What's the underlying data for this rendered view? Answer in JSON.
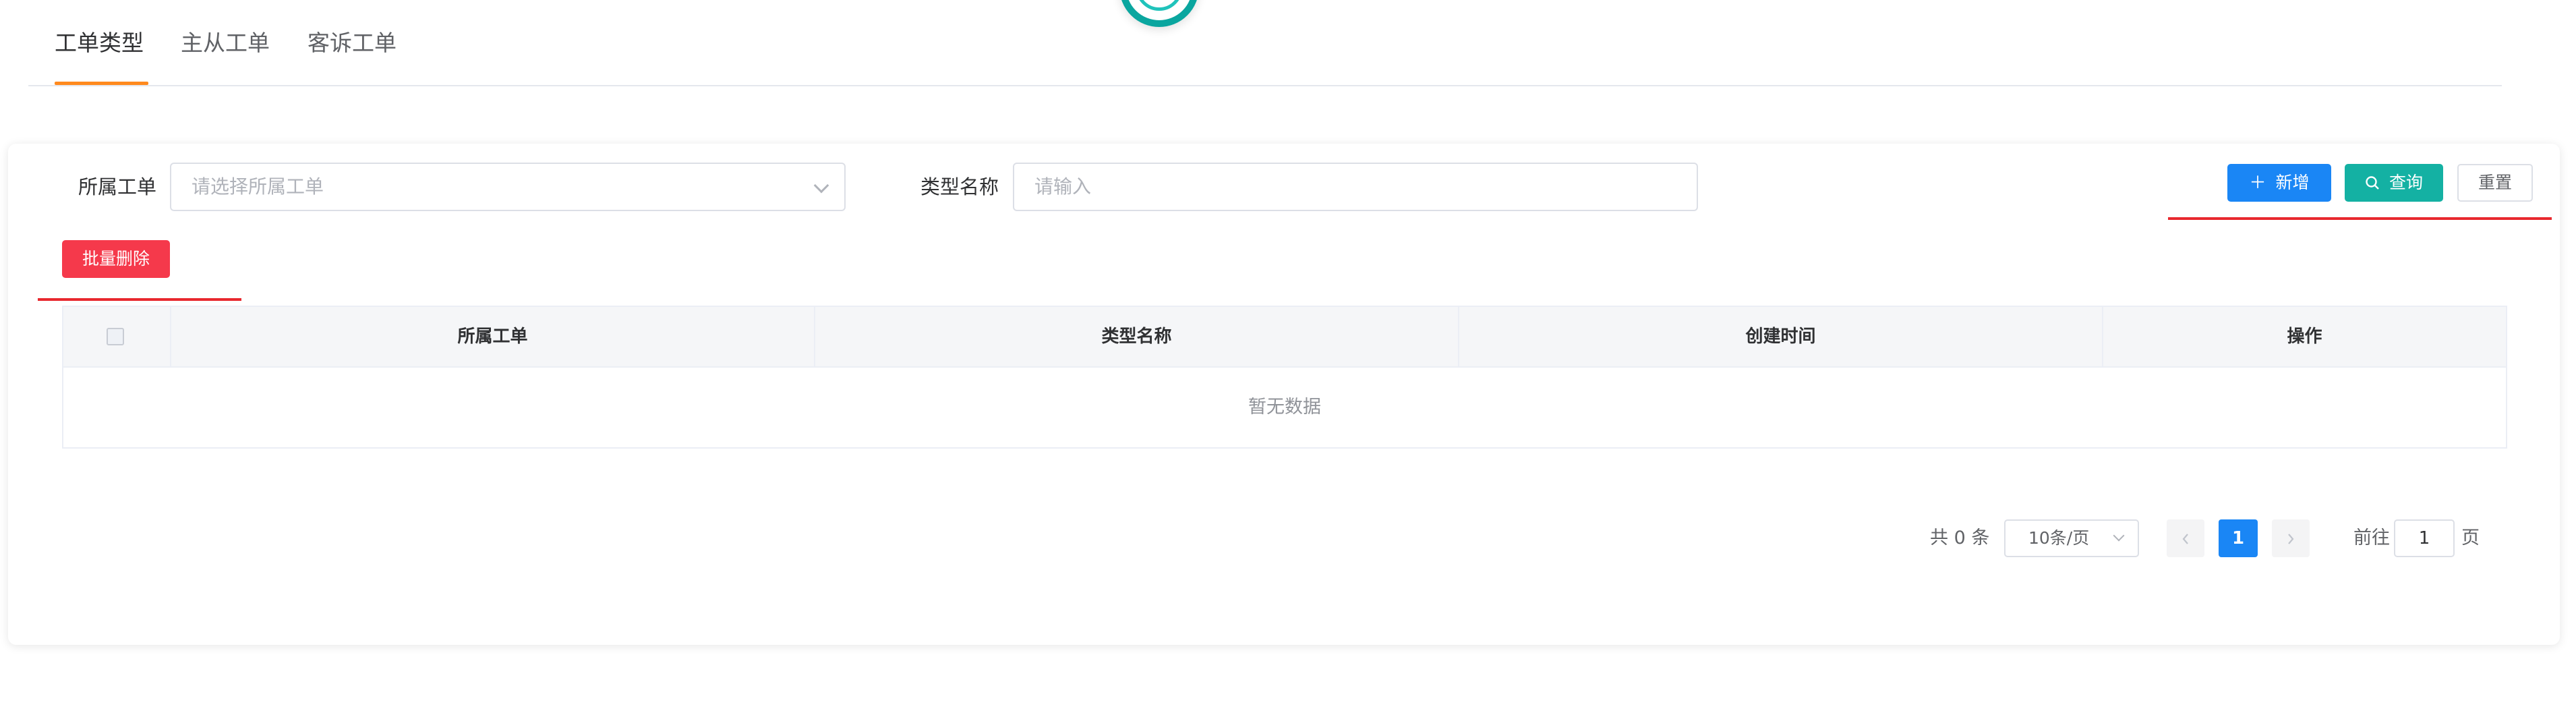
{
  "tabs": [
    {
      "label": "工单类型",
      "active": true
    },
    {
      "label": "主从工单",
      "active": false
    },
    {
      "label": "客诉工单",
      "active": false
    }
  ],
  "filters": {
    "order_label": "所属工单",
    "order_placeholder": "请选择所属工单",
    "type_label": "类型名称",
    "type_placeholder": "请输入"
  },
  "actions": {
    "add": "新增",
    "query": "查询",
    "reset": "重置",
    "batch_delete": "批量删除"
  },
  "table": {
    "columns": [
      "所属工单",
      "类型名称",
      "创建时间",
      "操作"
    ],
    "empty_text": "暂无数据"
  },
  "pagination": {
    "total": "共 0 条",
    "page_size": "10条/页",
    "current_page": "1",
    "goto_label": "前往",
    "goto_value": "1",
    "page_suffix": "页"
  },
  "colors": {
    "primary": "#1a86f5",
    "teal": "#14b1a3",
    "danger": "#f5394b",
    "tab_accent": "#ff8a1e",
    "annotation_red": "#e8282e"
  }
}
